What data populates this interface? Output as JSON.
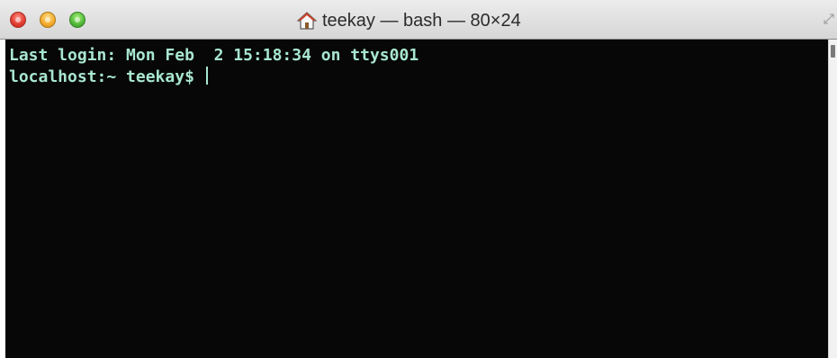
{
  "window": {
    "title": "teekay — bash — 80×24",
    "title_icon": "house-icon"
  },
  "controls": {
    "close_icon": "close-icon",
    "minimize_icon": "minimize-icon",
    "zoom_icon": "zoom-icon",
    "resize_icon": "resize-icon"
  },
  "terminal": {
    "lines": [
      "Last login: Mon Feb  2 15:18:34 on ttys001",
      "localhost:~ teekay$ "
    ],
    "text_color": "#a8e6cf",
    "background_color": "#070707"
  }
}
